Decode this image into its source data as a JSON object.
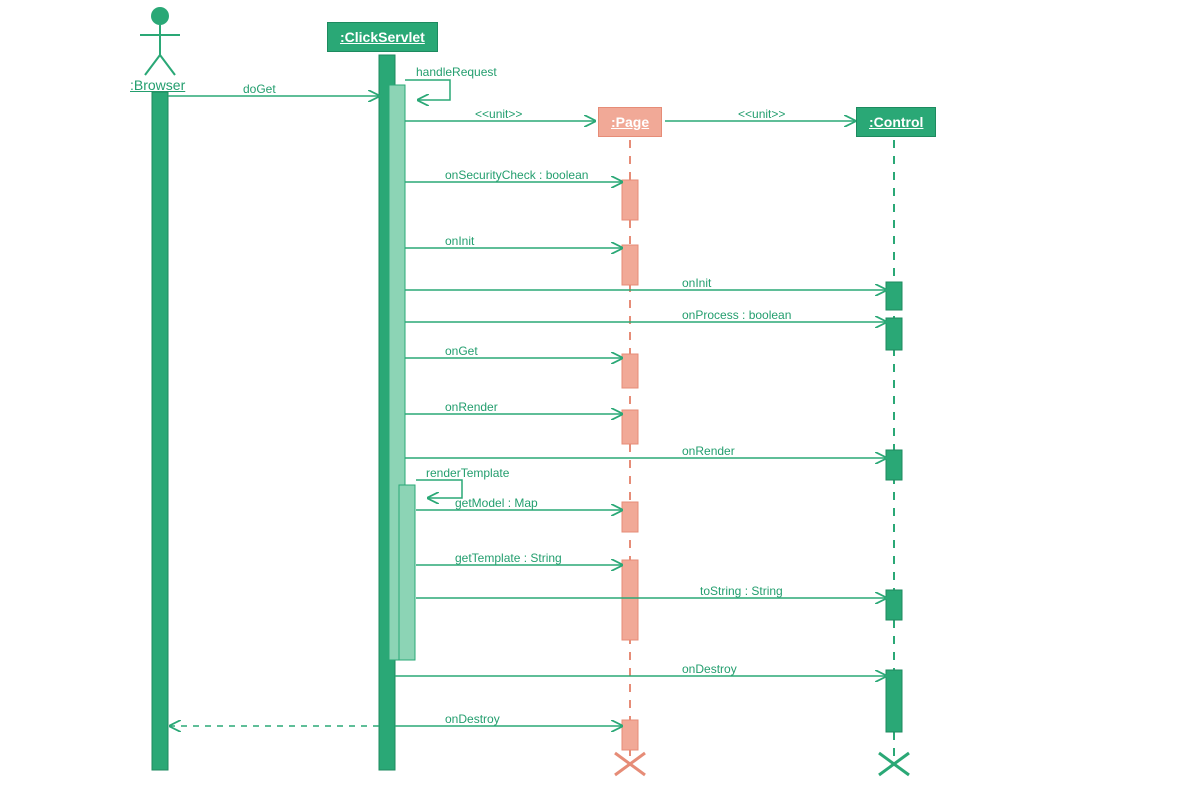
{
  "actors": {
    "browser": ":Browser",
    "clickServlet": ":ClickServlet",
    "page": ":Page",
    "control": ":Control"
  },
  "messages": {
    "doGet": "doGet",
    "handleRequest": "handleRequest",
    "unit1": "<<unit>>",
    "unit2": "<<unit>>",
    "onSecurityCheck": "onSecurityCheck : boolean",
    "onInitPage": "onInit",
    "onInitControl": "onInit",
    "onProcess": "onProcess : boolean",
    "onGet": "onGet",
    "onRenderPage": "onRender",
    "onRenderControl": "onRender",
    "renderTemplate": "renderTemplate",
    "getModel": "getModel : Map",
    "getTemplate": "getTemplate : String",
    "toString": "toString : String",
    "onDestroyControl": "onDestroy",
    "onDestroyPage": "onDestroy"
  }
}
